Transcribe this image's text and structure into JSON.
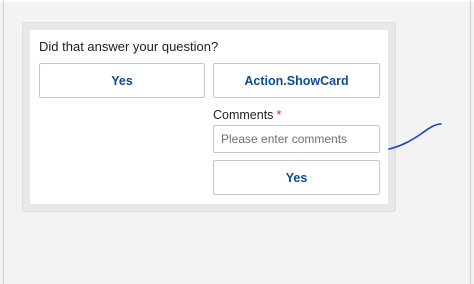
{
  "card": {
    "question": "Did that answer your question?",
    "actions": {
      "yes_label": "Yes",
      "showcard_label": "Action.ShowCard"
    },
    "showcard": {
      "comments_label": "Comments",
      "required_marker": "*",
      "comments_placeholder": "Please enter comments",
      "comments_value": "",
      "submit_label": "Yes"
    }
  },
  "colors": {
    "action_text": "#0f4b8f",
    "required_marker": "#d13438",
    "annotation_ink": "#1f3fbf",
    "frame_background": "#e6e8ea",
    "page_background": "#f3f3f3"
  },
  "icons": {
    "annotation": "pen-stroke-annotation"
  }
}
